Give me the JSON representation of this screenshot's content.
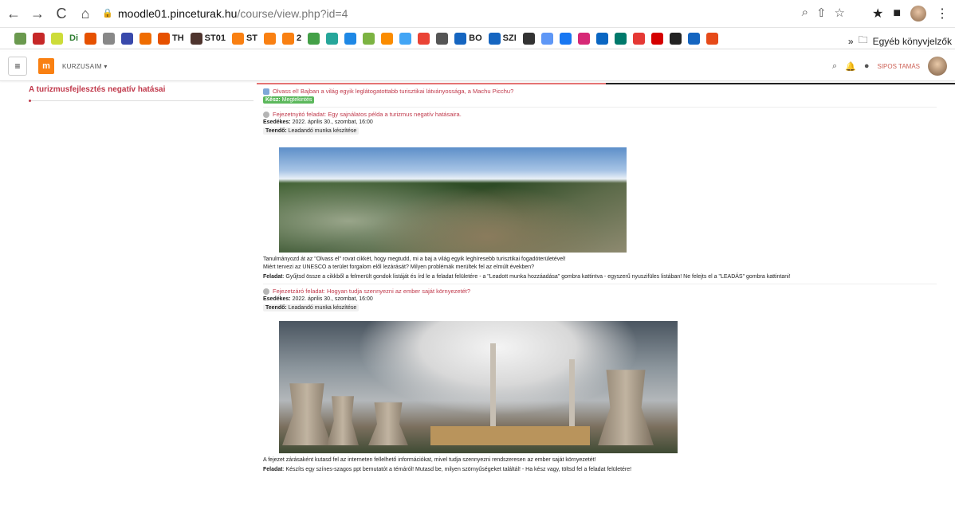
{
  "browser": {
    "url_host": "moodle01.pinceturak.hu",
    "url_path": "/course/view.php?id=4",
    "bookmarks": [
      {
        "label": "Di",
        "color": "#2e7d32"
      },
      {
        "label": "TH",
        "color": "#e65100"
      },
      {
        "label": "ST01",
        "color": "#4e342e"
      },
      {
        "label": "ST",
        "color": "#f98012"
      },
      {
        "label": "2",
        "color": "#f98012"
      },
      {
        "label": "BO",
        "color": "#1565c0"
      },
      {
        "label": "SZI",
        "color": "#1565c0"
      }
    ],
    "bookmarks_folder": "Egyéb könyvjelzők",
    "bookmarks_more": "»"
  },
  "moodle": {
    "courses_menu": "KURZUSAIM ▾",
    "user_name": "SIPOS TAMÁS"
  },
  "sidebar": {
    "title": "A turizmusfejlesztés negatív hatásai"
  },
  "progress": {
    "fraction": 0.5
  },
  "activities": [
    {
      "title": "Olvass el! Bajban a világ egyik leglátogatottabb turisztikai látványossága, a Machu Picchu?",
      "done_label": "Kész:",
      "done_value": "Megtekintés"
    },
    {
      "title": "Fejezetnyitó feladat: Egy sajnálatos példa a turizmus negatív hatásaira.",
      "due_label": "Esedékes:",
      "due_value": "2022. április 30., szombat, 16:00",
      "todo_label": "Teendő:",
      "todo_value": "Leadandó munka készítése",
      "para1": "Tanulmányozd át az \"Olvass el\" rovat cikkét, hogy megtudd, mi a baj a világ egyik leghíresebb turisztikai fogadóterületével!",
      "para2": "Miért tervezi az UNESCO a terület forgalom elől lezárását? Milyen problémák merültek fel az elmúlt években?",
      "task_label": "Feladat",
      "task_text": ": Gyűjtsd össze a cikkből a felmerült gondok listáját és írd le a feladat felületére - a \"Leadott munka hozzáadása\" gombra kattintva - egyszerű nyuszifüles listában! Ne felejts el a \"LEADÁS\" gombra kattintani!"
    },
    {
      "title": "Fejezetzáró feladat: Hogyan tudja szennyezni az ember saját környezetét?",
      "due_label": "Esedékes:",
      "due_value": "2022. április 30., szombat, 16:00",
      "todo_label": "Teendő:",
      "todo_value": "Leadandó munka készítése",
      "para1": "A fejezet zárásaként kutasd fel az interneten fellelhető információkat, mivel tudja szennyezni rendszeresen az ember saját környezetét!",
      "task_label": "Feladat",
      "task_text": ": Készíts egy színes-szagos ppt bemutatót a témáról! Mutasd be, milyen szörnyűségeket találtál! - Ha kész vagy, töltsd fel a feladat felületére!"
    }
  ]
}
